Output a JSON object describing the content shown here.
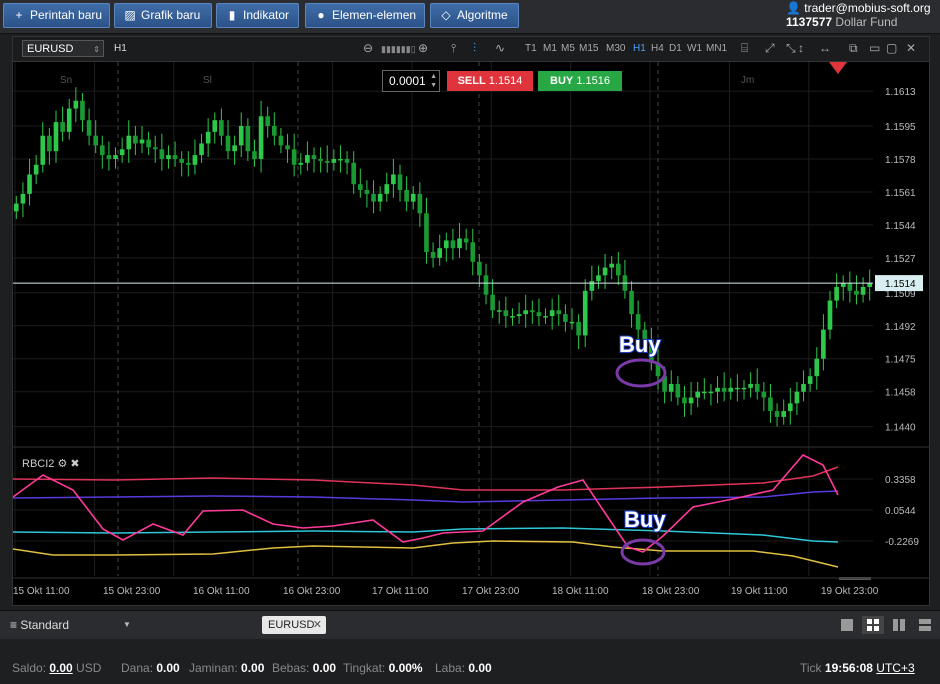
{
  "toolbar": {
    "new_order": "Perintah baru",
    "new_chart": "Grafik baru",
    "indicator": "Indikator",
    "elements": "Elemen-elemen",
    "algorithm": "Algoritme"
  },
  "account": {
    "user": "trader@mobius-soft.org",
    "number": "1137577",
    "fund": "Dollar Fund"
  },
  "chart": {
    "symbol": "EURUSD",
    "timeframe": "H1",
    "timeframes": [
      "T1",
      "M1",
      "M5",
      "M15",
      "M30",
      "H1",
      "H4",
      "D1",
      "W1",
      "MN1"
    ],
    "active_timeframe": "H1",
    "sessions": [
      "Sn",
      "Sl",
      "Jm"
    ],
    "trade": {
      "step": "0.0001",
      "sell_label": "SELL",
      "sell_price": "1.1514",
      "buy_label": "BUY",
      "buy_price": "1.1516"
    },
    "current_price": "1.1514",
    "annotation_main": "Buy",
    "annotation_indicator": "Buy",
    "indicator_name": "RBCI2"
  },
  "chart_data": {
    "type": "candlestick",
    "price_ticks": [
      "1.1613",
      "1.1595",
      "1.1578",
      "1.1561",
      "1.1544",
      "1.1527",
      "1.1509",
      "1.1492",
      "1.1475",
      "1.1458",
      "1.1440"
    ],
    "indicator_ticks": [
      "0.3358",
      "0.0544",
      "-0.2269"
    ],
    "x_labels": [
      "15 Okt 11:00",
      "15 Okt 23:00",
      "16 Okt 11:00",
      "16 Okt 23:00",
      "17 Okt 11:00",
      "17 Okt 23:00",
      "18 Okt 11:00",
      "18 Okt 23:00",
      "19 Okt 11:00",
      "19 Okt 23:00"
    ],
    "ylim": [
      1.143,
      1.1628
    ],
    "close": [
      1.1555,
      1.156,
      1.157,
      1.1575,
      1.159,
      1.1582,
      1.1597,
      1.1592,
      1.1604,
      1.1608,
      1.1598,
      1.159,
      1.1585,
      1.158,
      1.1578,
      1.158,
      1.1583,
      1.159,
      1.1586,
      1.1588,
      1.1584,
      1.1583,
      1.1578,
      1.158,
      1.1578,
      1.1576,
      1.1575,
      1.158,
      1.1586,
      1.1592,
      1.1598,
      1.159,
      1.1582,
      1.1585,
      1.1595,
      1.1582,
      1.1578,
      1.16,
      1.1595,
      1.159,
      1.1585,
      1.1583,
      1.1575,
      1.1576,
      1.158,
      1.1578,
      1.1577,
      1.1576,
      1.1578,
      1.1578,
      1.1576,
      1.1565,
      1.1562,
      1.156,
      1.1556,
      1.156,
      1.1565,
      1.157,
      1.1562,
      1.1556,
      1.156,
      1.155,
      1.153,
      1.1527,
      1.1532,
      1.1536,
      1.1532,
      1.1537,
      1.1535,
      1.1525,
      1.1518,
      1.1508,
      1.15,
      1.15,
      1.1497,
      1.1497,
      1.1498,
      1.15,
      1.1499,
      1.1497,
      1.1497,
      1.15,
      1.1498,
      1.1494,
      1.1494,
      1.1487,
      1.151,
      1.1515,
      1.1518,
      1.1522,
      1.1524,
      1.1518,
      1.151,
      1.1498,
      1.149,
      1.1485,
      1.1473,
      1.1466,
      1.1458,
      1.1462,
      1.1455,
      1.1452,
      1.1455,
      1.1458,
      1.1458,
      1.1458,
      1.146,
      1.1458,
      1.146,
      1.146,
      1.146,
      1.1462,
      1.1458,
      1.1455,
      1.1448,
      1.1445,
      1.1448,
      1.1452,
      1.1458,
      1.1462,
      1.1466,
      1.1475,
      1.149,
      1.1505,
      1.1512,
      1.1514,
      1.151,
      1.1508,
      1.1512,
      1.1514
    ]
  }
}
